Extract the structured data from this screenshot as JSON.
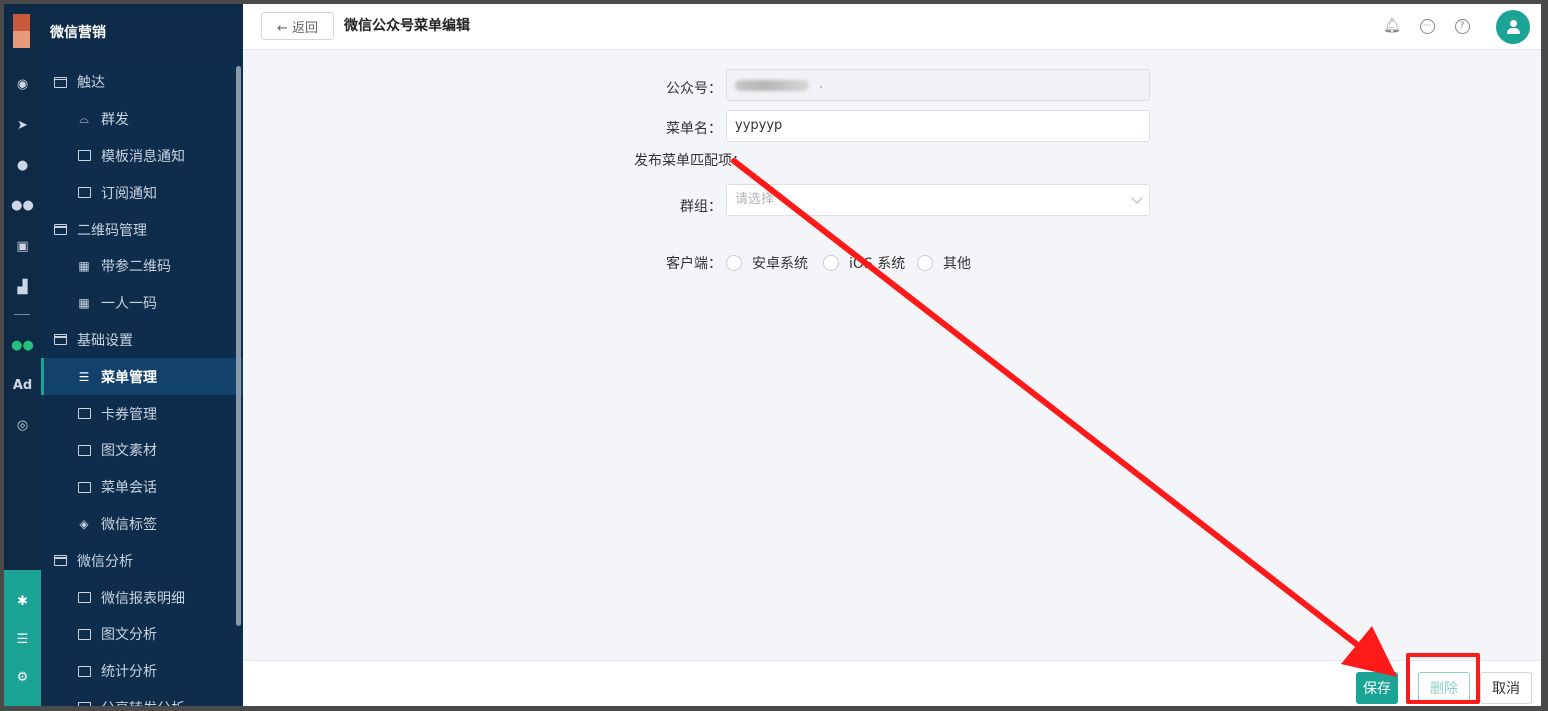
{
  "sidebar": {
    "title": "微信营销",
    "groups": [
      {
        "label": "触达",
        "items": [
          {
            "icon": "broadcast-icon",
            "glyph": "📢",
            "label": "群发"
          },
          {
            "icon": "template-icon",
            "label": "模板消息通知"
          },
          {
            "icon": "subscribe-icon",
            "label": "订阅通知"
          }
        ]
      },
      {
        "label": "二维码管理",
        "items": [
          {
            "icon": "qrcode-icon",
            "label": "带参二维码"
          },
          {
            "icon": "qrcode-person-icon",
            "label": "一人一码"
          }
        ]
      },
      {
        "label": "基础设置",
        "items": [
          {
            "icon": "menu-list-icon",
            "label": "菜单管理",
            "active": true
          },
          {
            "icon": "coupon-icon",
            "label": "卡券管理"
          },
          {
            "icon": "article-icon",
            "label": "图文素材"
          },
          {
            "icon": "chat-icon",
            "label": "菜单会话"
          },
          {
            "icon": "tag-icon",
            "label": "微信标签"
          }
        ]
      },
      {
        "label": "微信分析",
        "items": [
          {
            "icon": "report-icon",
            "label": "微信报表明细"
          },
          {
            "icon": "article-analysis-icon",
            "label": "图文分析"
          },
          {
            "icon": "stats-icon",
            "label": "统计分析"
          },
          {
            "icon": "share-icon",
            "label": "分享转发分析"
          }
        ]
      }
    ]
  },
  "rail": {
    "ad_label": "Ad"
  },
  "topbar": {
    "back_label": "← 返回",
    "page_title": "微信公众号菜单编辑"
  },
  "form": {
    "account_label": "公众号：",
    "account_suffix": ".",
    "menu_name_label": "菜单名：",
    "menu_name_value": "yypyyp",
    "publish_match_label": "发布菜单匹配项：",
    "group_label": "群组：",
    "group_placeholder": "请选择",
    "client_label": "客户端：",
    "client_options": [
      "安卓系统",
      "iOS 系统",
      "其他"
    ]
  },
  "footer": {
    "save_label": "保存",
    "delete_label": "删除",
    "cancel_label": "取消"
  },
  "colors": {
    "accent": "#1ba396",
    "sidebar_bg": "#0e2d4d",
    "annotation": "#ff1a1a"
  }
}
